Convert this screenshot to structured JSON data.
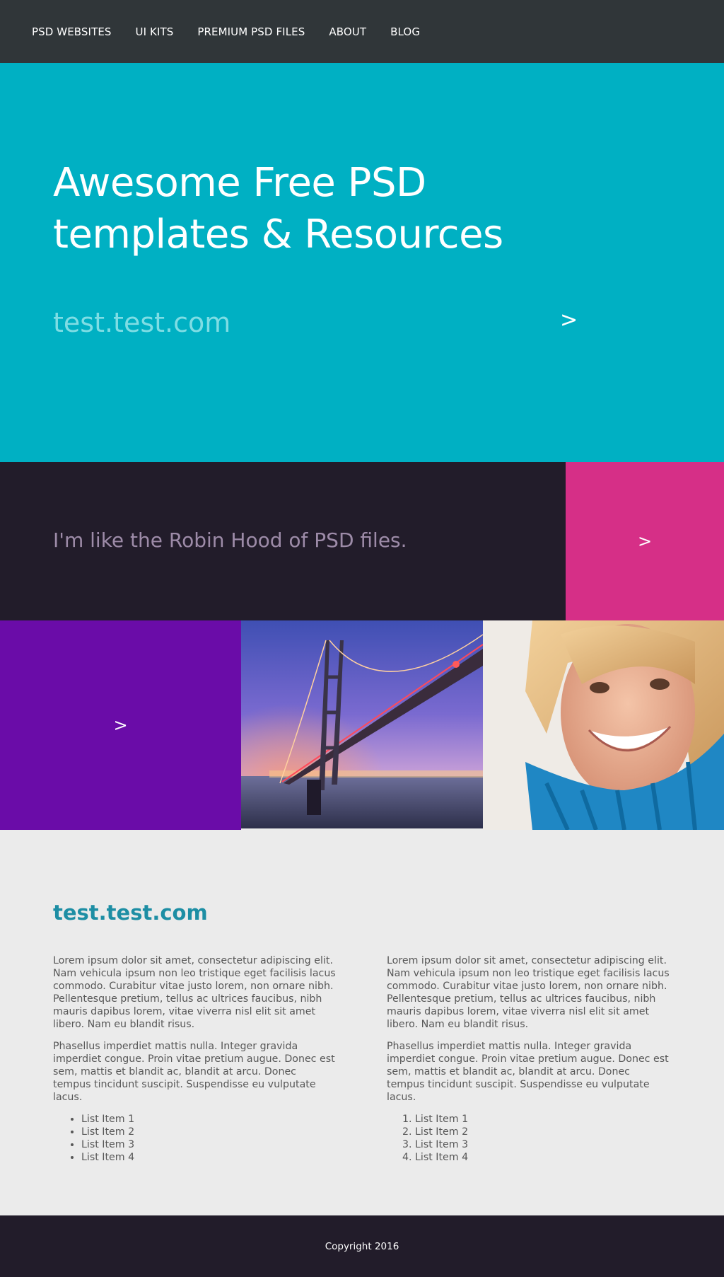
{
  "nav": {
    "items": [
      {
        "label": "PSD WEBSITES"
      },
      {
        "label": "UI KITS"
      },
      {
        "label": "PREMIUM PSD FILES"
      },
      {
        "label": "ABOUT"
      },
      {
        "label": "BLOG"
      }
    ]
  },
  "hero": {
    "title_line1": "Awesome Free PSD",
    "title_line2": "templates & Resources",
    "url": "test.test.com",
    "arrow": ">"
  },
  "quote": {
    "text": "I'm like the Robin Hood of PSD files.",
    "arrow": ">"
  },
  "tiles": {
    "purple_arrow": ">"
  },
  "content": {
    "title": "test.test.com",
    "left": {
      "p1": "Lorem ipsum dolor sit amet, consectetur adipiscing elit. Nam vehicula ipsum non leo tristique eget facilisis lacus commodo. Curabitur vitae justo lorem, non ornare nibh. Pellentesque pretium, tellus ac ultrices faucibus, nibh mauris dapibus lorem, vitae viverra nisl elit sit amet libero. Nam eu blandit risus.",
      "p2": "Phasellus imperdiet mattis nulla. Integer gravida imperdiet congue. Proin vitae pretium augue. Donec est sem, mattis et blandit ac, blandit at arcu. Donec tempus tincidunt suscipit. Suspendisse eu vulputate lacus.",
      "list": [
        "List Item 1",
        "List Item 2",
        "List Item 3",
        "List Item 4"
      ]
    },
    "right": {
      "p1": "Lorem ipsum dolor sit amet, consectetur adipiscing elit. Nam vehicula ipsum non leo tristique eget facilisis lacus commodo. Curabitur vitae justo lorem, non ornare nibh. Pellentesque pretium, tellus ac ultrices faucibus, nibh mauris dapibus lorem, vitae viverra nisl elit sit amet libero. Nam eu blandit risus.",
      "p2": "Phasellus imperdiet mattis nulla. Integer gravida imperdiet congue. Proin vitae pretium augue. Donec est sem, mattis et blandit ac, blandit at arcu. Donec tempus tincidunt suscipit. Suspendisse eu vulputate lacus.",
      "list": [
        "List Item 1",
        "List Item 2",
        "List Item 3",
        "List Item 4"
      ]
    }
  },
  "footer": {
    "copyright": "Copyright 2016"
  },
  "colors": {
    "nav_bg": "#303639",
    "hero_bg": "#00b0c3",
    "dark_band": "#221c2a",
    "pink": "#d62f87",
    "purple": "#6a0ca8",
    "content_title": "#1d8ea4"
  }
}
